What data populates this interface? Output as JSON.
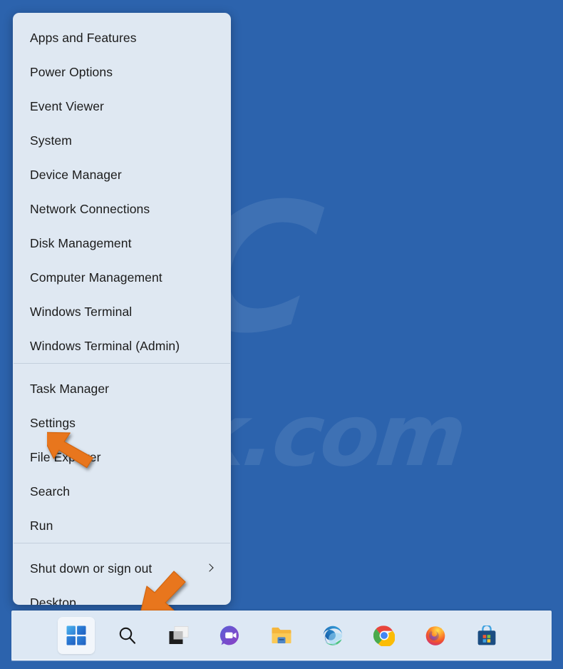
{
  "desktop": {
    "background_color": "#2c63ad",
    "watermark_mark": "PC",
    "watermark_domain": "risk.com"
  },
  "winx_menu": {
    "name": "Windows Quick Link menu",
    "background_color": "#dfe8f2",
    "groups": [
      {
        "items": [
          {
            "label": "Apps and Features",
            "submenu": false
          },
          {
            "label": "Power Options",
            "submenu": false
          },
          {
            "label": "Event Viewer",
            "submenu": false
          },
          {
            "label": "System",
            "submenu": false
          },
          {
            "label": "Device Manager",
            "submenu": false
          },
          {
            "label": "Network Connections",
            "submenu": false
          },
          {
            "label": "Disk Management",
            "submenu": false
          },
          {
            "label": "Computer Management",
            "submenu": false
          },
          {
            "label": "Windows Terminal",
            "submenu": false
          },
          {
            "label": "Windows Terminal (Admin)",
            "submenu": false
          }
        ]
      },
      {
        "items": [
          {
            "label": "Task Manager",
            "submenu": false
          },
          {
            "label": "Settings",
            "submenu": false
          },
          {
            "label": "File Explorer",
            "submenu": false
          },
          {
            "label": "Search",
            "submenu": false
          },
          {
            "label": "Run",
            "submenu": false
          }
        ]
      },
      {
        "items": [
          {
            "label": "Shut down or sign out",
            "submenu": true
          },
          {
            "label": "Desktop",
            "submenu": false
          }
        ]
      }
    ]
  },
  "annotations": {
    "arrow_color": "#e8761d",
    "arrow_settings_target": "Settings",
    "arrow_start_target": "Start button"
  },
  "taskbar": {
    "background_color": "#dde8f4",
    "icons": [
      {
        "name": "start-icon",
        "label": "Start",
        "active": true
      },
      {
        "name": "search-icon",
        "label": "Search",
        "active": false
      },
      {
        "name": "task-view-icon",
        "label": "Task View",
        "active": false
      },
      {
        "name": "chat-icon",
        "label": "Chat",
        "active": false
      },
      {
        "name": "file-explorer-icon",
        "label": "File Explorer",
        "active": false
      },
      {
        "name": "edge-icon",
        "label": "Microsoft Edge",
        "active": false
      },
      {
        "name": "chrome-icon",
        "label": "Google Chrome",
        "active": false
      },
      {
        "name": "firefox-icon",
        "label": "Mozilla Firefox",
        "active": false
      },
      {
        "name": "microsoft-store-icon",
        "label": "Microsoft Store",
        "active": false
      }
    ]
  }
}
